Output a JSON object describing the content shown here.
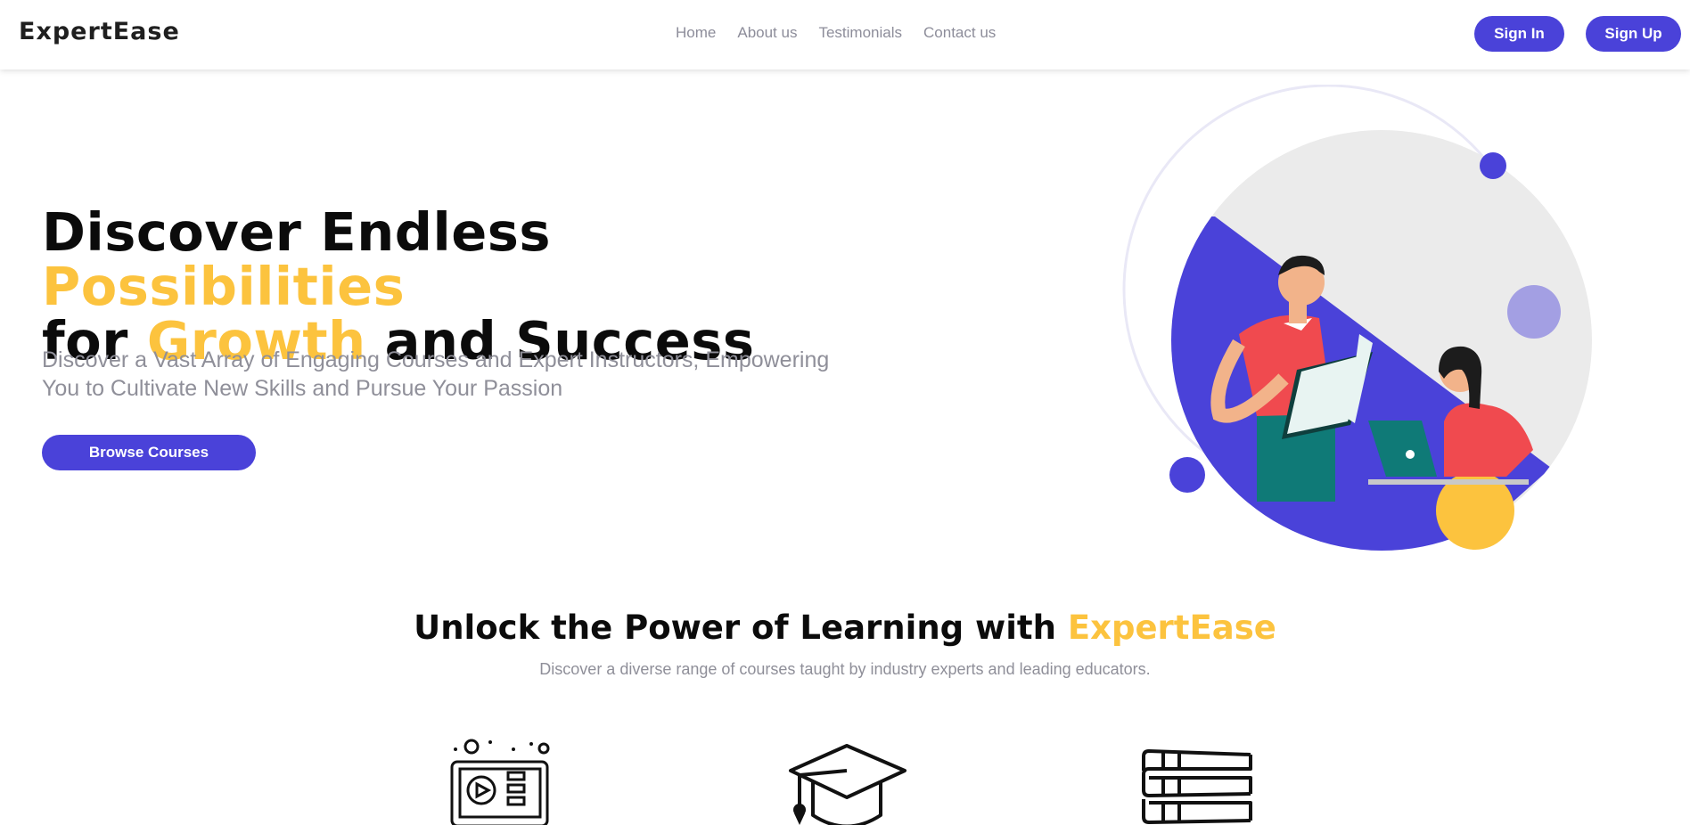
{
  "brand": {
    "name": "ExpertEase"
  },
  "nav": {
    "items": [
      {
        "label": "Home"
      },
      {
        "label": "About us"
      },
      {
        "label": "Testimonials"
      },
      {
        "label": "Contact us"
      }
    ]
  },
  "auth": {
    "sign_in": "Sign In",
    "sign_up": "Sign Up"
  },
  "hero": {
    "title_part1": "Discover Endless ",
    "title_accent1": "Possibilities",
    "title_part2": "for ",
    "title_accent2": "Growth",
    "title_part3": " and Success",
    "subtitle": "Discover a Vast Array of Engaging Courses and Expert Instructors, Empowering You to Cultivate New Skills and Pursue Your Passion",
    "cta": "Browse Courses"
  },
  "features": {
    "title_part1": "Unlock the Power of Learning with ",
    "title_accent": "ExpertEase",
    "subtitle": "Discover a diverse range of courses taught by industry experts and leading educators.",
    "icons": [
      "video-lesson-icon",
      "graduation-cap-icon",
      "books-stack-icon"
    ]
  },
  "colors": {
    "primary": "#4a42d9",
    "accent": "#fcc33e",
    "muted_text": "#8f8f99",
    "light_gray": "#ebebeb",
    "lavender": "#a39fe3"
  }
}
